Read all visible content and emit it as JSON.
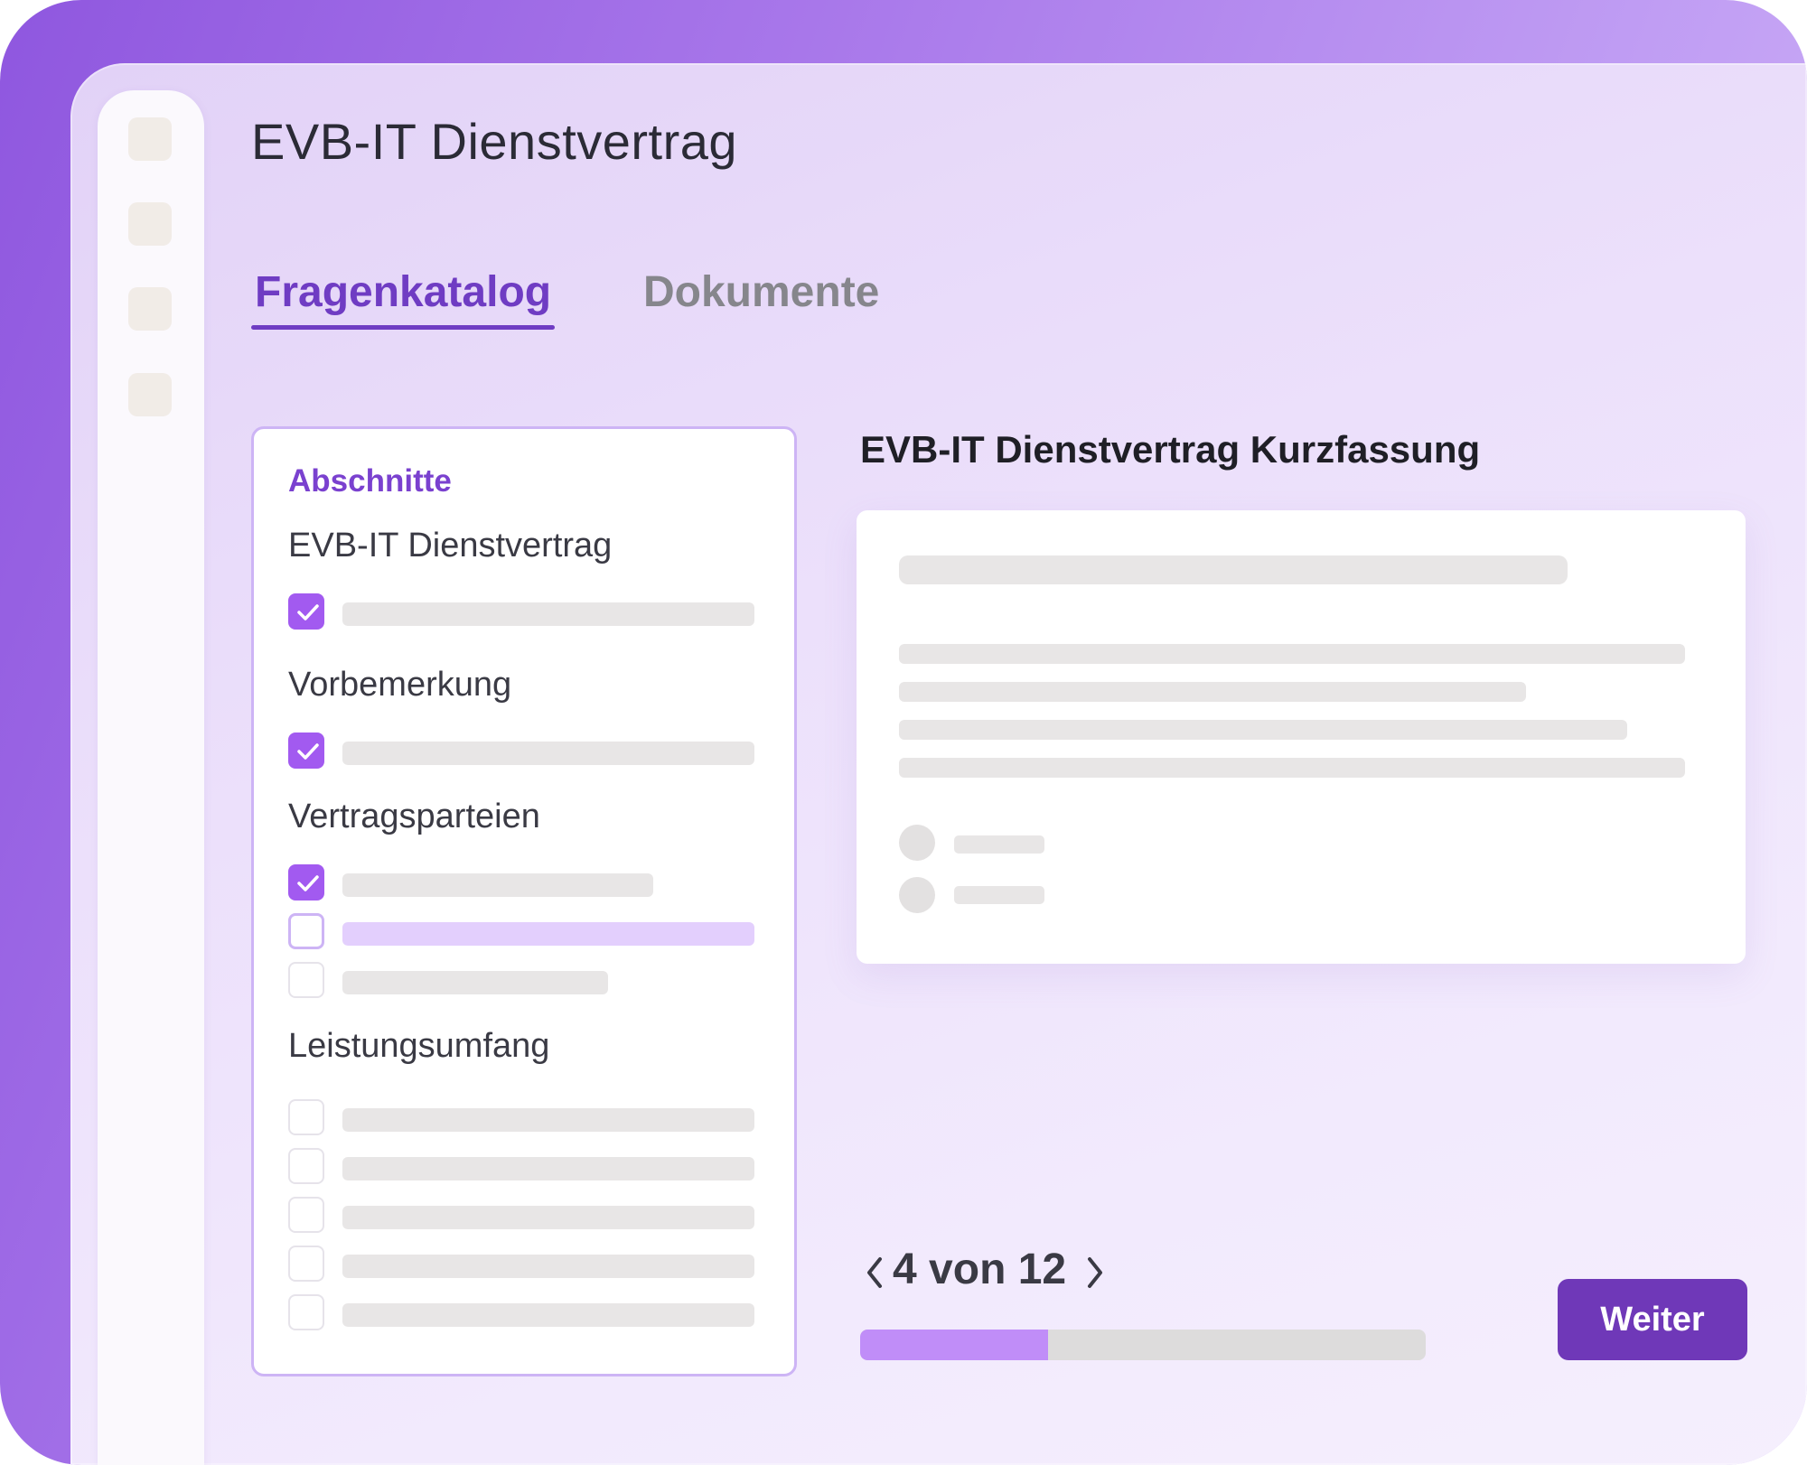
{
  "page": {
    "title": "EVB-IT Dienstvertrag"
  },
  "tabs": [
    {
      "label": "Fragenkatalog",
      "active": true
    },
    {
      "label": "Dokumente",
      "active": false
    }
  ],
  "sections": {
    "heading": "Abschnitte",
    "groups": [
      {
        "title": "EVB-IT Dienstvertrag",
        "items": [
          {
            "checked": true
          }
        ]
      },
      {
        "title": "Vorbemerkung",
        "items": [
          {
            "checked": true
          }
        ]
      },
      {
        "title": "Vertragsparteien",
        "items": [
          {
            "checked": true
          },
          {
            "checked": false,
            "current": true
          },
          {
            "checked": false
          }
        ]
      },
      {
        "title": "Leistungsumfang",
        "items": [
          {
            "checked": false
          },
          {
            "checked": false
          },
          {
            "checked": false
          },
          {
            "checked": false
          },
          {
            "checked": false
          }
        ]
      }
    ]
  },
  "document": {
    "heading": "EVB-IT Dienstvertrag Kurzfassung"
  },
  "pagination": {
    "current": 4,
    "total": 12,
    "separator": "von",
    "progress_fraction": 0.333
  },
  "actions": {
    "next_label": "Weiter"
  },
  "colors": {
    "accent": "#6f3cc3",
    "checkbox_checked": "#a25af0",
    "current_item_highlight": "#e3cffd",
    "progress_fill": "#c08df8",
    "button_bg": "#6f38b8"
  },
  "icons": {
    "checkbox_check": "check-icon",
    "pager_prev": "chevron-left-icon",
    "pager_next": "chevron-right-icon"
  }
}
